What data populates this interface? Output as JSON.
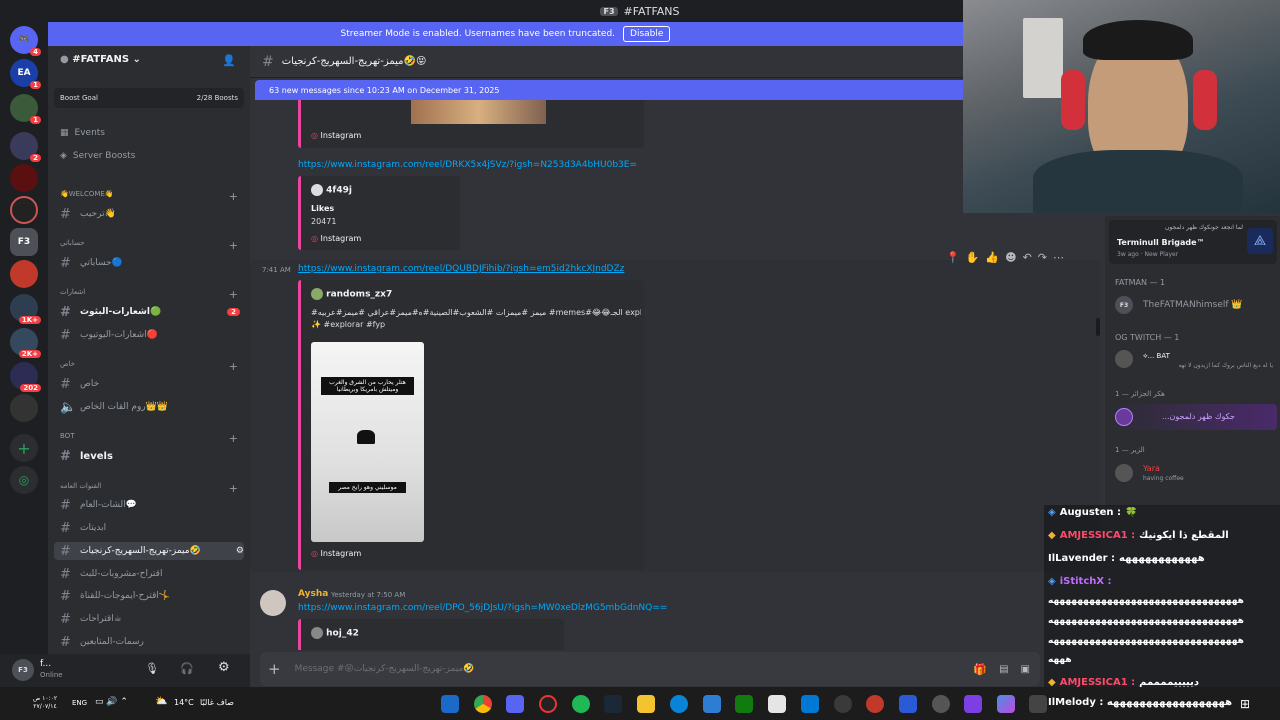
{
  "window": {
    "title": "#FATFANS",
    "logo": "F3"
  },
  "streamer_banner": {
    "text": "Streamer Mode is enabled. Usernames have been truncated.",
    "button": "Disable"
  },
  "server_list": [
    {
      "label": "",
      "badge": "4"
    },
    {
      "label": "EA",
      "badge": "1"
    },
    {
      "label": "",
      "badge": "1"
    },
    {
      "label": "",
      "badge": "2"
    },
    {
      "label": "",
      "badge": ""
    },
    {
      "label": "",
      "badge": ""
    },
    {
      "label": "F3",
      "badge": ""
    },
    {
      "label": "",
      "badge": ""
    },
    {
      "label": "",
      "badge": "1K+"
    },
    {
      "label": "",
      "badge": "2K+"
    },
    {
      "label": "",
      "badge": "202"
    },
    {
      "label": "",
      "badge": ""
    }
  ],
  "sidebar": {
    "server_name": "#FATFANS",
    "boost_goal": "Boost Goal",
    "boost_count": "2/28 Boosts",
    "events": "Events",
    "server_boosts": "Server Boosts",
    "categories": [
      {
        "name": "👋WELCOME👋",
        "channels": [
          "ترحيب👋"
        ]
      },
      {
        "name": "حساباتي",
        "channels": [
          "حساباتي🔵"
        ]
      },
      {
        "name": "اشعارات",
        "channels": [
          "اشعارات-البثوث🟢",
          "اشعارات-اليوتيوب🔴"
        ],
        "badge": "2"
      },
      {
        "name": "خاص",
        "channels": [
          "خاص",
          "روم القات الخاص👑👑"
        ]
      },
      {
        "name": "BOT",
        "channels": [
          "levels"
        ]
      },
      {
        "name": "القنوات العامه",
        "channels": [
          "الشات-العام💬",
          "ابديتات",
          "ميمز-تهريج-السهريج-كرنجيات🤣",
          "اقتراح-مشروبات-للبث",
          "اقترح-ايموجات-للقناة🤸",
          "اقتراحات☕",
          "رسمات-المتابعين"
        ]
      }
    ]
  },
  "user": {
    "name": "f...",
    "status": "Online"
  },
  "header": {
    "channel": "ميمز-تهريج-السهريج-كرنجيات🤣😝"
  },
  "new_messages": "63 new messages since 10:23 AM on December 31, 2025",
  "messages": {
    "embed1_source": "Instagram",
    "link2": "https://www.instagram.com/reel/DRKX5x4jSVz/?igsh=N253d3A4bHU0b3E=",
    "embed2_author": "4f49j",
    "embed2_likes_label": "Likes",
    "embed2_likes": "20471",
    "embed2_source": "Instagram",
    "msg3_time": "7:41 AM",
    "link3": "https://www.instagram.com/reel/DQUBDJFihib/?igsh=em5id2hkcXJndDZz",
    "embed3_author": "randoms_zx7",
    "embed3_desc": "#ميمز #ميمزات #الشعوب#الصينية#ه#ميمز#عراقي #ميمز#عربيه #memes#😂😂الجـ explorepage#",
    "embed3_desc2": "✨ #explorar #fyp",
    "embed3_caption_top": "هتلر يحارب من الشرق والغرب وميتلش بامريكا وبريطانيا",
    "embed3_caption_bottom": "موسليني وهو رايح مصر",
    "embed3_source": "Instagram",
    "msg4_author": "Aysha",
    "msg4_time": "Yesterday at 7:50 AM",
    "link4": "https://www.instagram.com/reel/DPO_56jDJsU/?igsh=MW0xeDlzMG5mbGdnNQ==",
    "embed4_author": "hoj_42"
  },
  "composer": {
    "placeholder": "Message #😝ميمز-تهريج-السهريج-كرنجيات🤣"
  },
  "members": {
    "activity_title": "لما انجعد جونكوك ظهر دلمجون",
    "activity_game": "Terminull Brigade™",
    "activity_meta": "3w ago · New Player",
    "groups": [
      {
        "title": "FATMAN — 1",
        "members": [
          {
            "name": "TheFATMANhimself 👑",
            "sub": ""
          }
        ]
      },
      {
        "title": "OG TWITCH — 1",
        "members": [
          {
            "name": "⟡...  BAT",
            "sub": "يا له ديع الناس بروك كما ازيدون لا تهه"
          }
        ]
      },
      {
        "title": "هكر الجزائر — 1",
        "members": [
          {
            "name": "جكوك ظهر دلمجون...",
            "sub": ""
          }
        ]
      },
      {
        "title": "الزير — 1",
        "members": [
          {
            "name": "Yara",
            "sub": "having coffee"
          }
        ]
      }
    ]
  },
  "chat_overlay": [
    {
      "user": "Augusten :",
      "msg": "🍀",
      "color": "#ffffff"
    },
    {
      "user": "AMJESSICA1 :",
      "msg": "المقطع ذا ايكونيك",
      "color": "#ff4a6a"
    },
    {
      "user": "IlLavender :",
      "msg": "ههههههههههههه",
      "color": "#ffffff"
    },
    {
      "user": "iStitchX :",
      "msg": "",
      "color": "#c06cff"
    },
    {
      "user": "",
      "msg": "ههههههههههههههههههههههههههههههههه",
      "color": "#ffffff"
    },
    {
      "user": "",
      "msg": "ههههههههههههههههههههههههههههههههه",
      "color": "#ffffff"
    },
    {
      "user": "",
      "msg": "ههههههههههههههههههههههههههههههههه",
      "color": "#ffffff"
    },
    {
      "user": "",
      "msg": "هههه",
      "color": "#ffffff"
    },
    {
      "user": "AMJESSICA1 :",
      "msg": "ديييييممممم",
      "color": "#ff4a6a"
    },
    {
      "user": "IlMelody :",
      "msg": "ههههههههههههههههههه",
      "color": "#ffffff"
    }
  ],
  "taskbar": {
    "date1": "١٠:٠٢ ص",
    "date2": "٢٧/٠٧/١٤",
    "lang": "ENG",
    "weather_temp": "14°C",
    "weather_text": "صاف غالبًا"
  },
  "colors": {
    "accent": "#5865f2",
    "link": "#00a8fc",
    "embed_border": "#eb459e",
    "mention_badge": "#f23f43"
  }
}
